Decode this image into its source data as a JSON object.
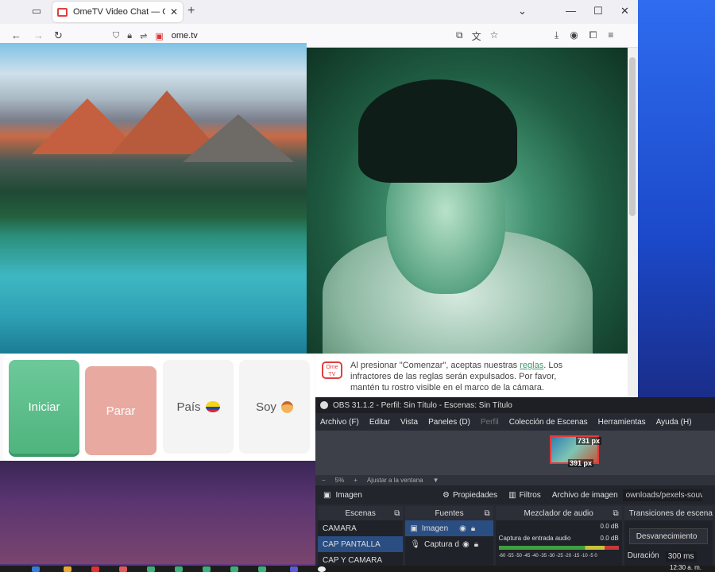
{
  "browser": {
    "tab_title": "OmeTV Video Chat — Omegle",
    "url": "ome.tv"
  },
  "page": {
    "buttons": {
      "start": "Iniciar",
      "stop": "Parar",
      "country": "País",
      "gender": "Soy"
    },
    "chat": {
      "logo_text": "Ome TV",
      "text_before_link": "Al presionar \"Comenzar\", aceptas nuestras ",
      "link": "reglas",
      "text_after_link": ". Los infractores de las reglas serán expulsados. Por favor, mantén tu rostro visible en el marco de la cámara."
    }
  },
  "obs": {
    "title": "OBS 31.1.2 - Perfil: Sin Título - Escenas: Sin Título",
    "menu": [
      "Archivo (F)",
      "Editar",
      "Vista",
      "Paneles (D)",
      "Perfil",
      "Colección de Escenas",
      "Herramientas",
      "Ayuda (H)"
    ],
    "preview": {
      "width_label": "731 px",
      "height_label": "391 px"
    },
    "zoom": {
      "minus": "−",
      "value": "5%",
      "plus": "+",
      "fit": "Ajustar a la ventana"
    },
    "source_bar": {
      "selected": "Imagen",
      "properties": "Propiedades",
      "filters": "Filtros",
      "image_file_label": "Archivo de imagen",
      "path": "ownloads/pexels-souv"
    },
    "docks": {
      "scenes_title": "Escenas",
      "scenes": [
        "CAMARA",
        "CAP PANTALLA",
        "CAP Y CAMARA"
      ],
      "sources_title": "Fuentes",
      "sources": [
        "Imagen",
        "Captura d"
      ],
      "mixer_title": "Mezclador de audio",
      "mixer_db_top": "0.0 dB",
      "mixer_channel": "Captura de entrada audio",
      "mixer_db": "0.0 dB",
      "mixer_scale": "-60 -55 -50 -45 -40 -35 -30 -25 -20 -15 -10 -5 0",
      "transitions_title": "Transiciones de escena",
      "transition": "Desvanecimiento",
      "duration_label": "Duración",
      "duration_value": "300 ms"
    }
  },
  "taskbar": {
    "clock": "12:30 a. m."
  }
}
